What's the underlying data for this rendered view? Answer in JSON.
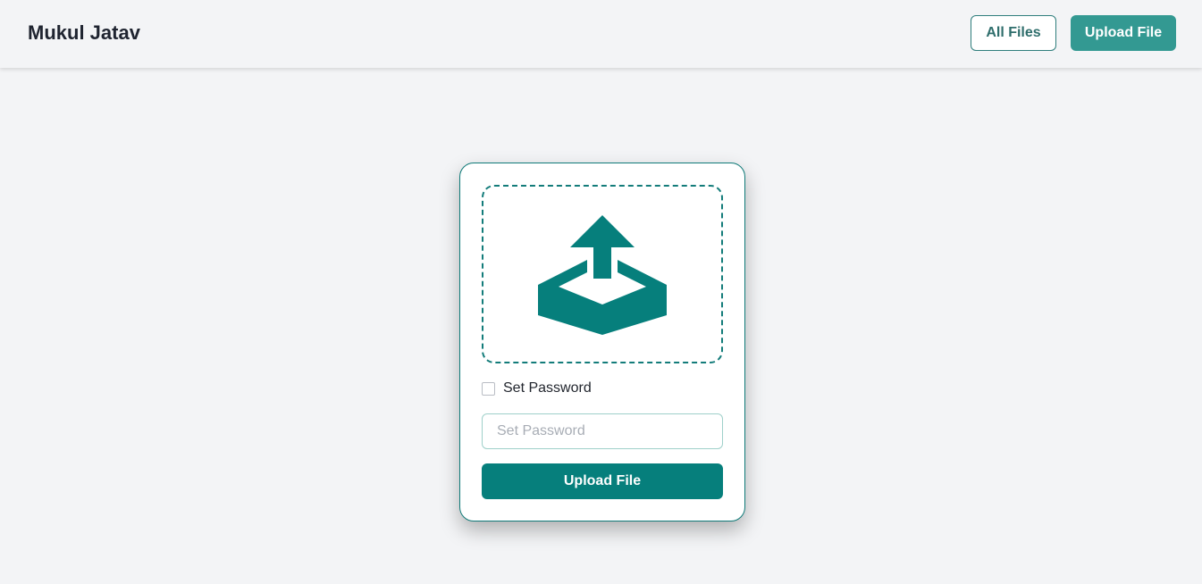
{
  "navbar": {
    "brand": "Mukul Jatav",
    "all_files_label": "All Files",
    "upload_file_label": "Upload File"
  },
  "upload_card": {
    "dropzone_icon": "upload-tray-icon",
    "set_password_checkbox": {
      "label": "Set Password",
      "checked": false
    },
    "password_input": {
      "value": "",
      "placeholder": "Set Password"
    },
    "submit_label": "Upload File"
  },
  "colors": {
    "accent": "#067f7c",
    "nav_button": "#339992",
    "background": "#f3f4f6"
  }
}
